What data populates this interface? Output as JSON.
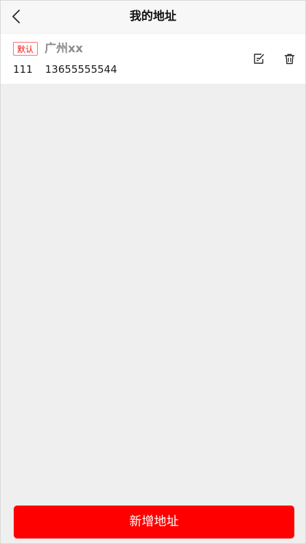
{
  "header": {
    "title": "我的地址",
    "back_icon": "chevron-left-icon"
  },
  "address_list": [
    {
      "badge": "默认",
      "address": "广州xx",
      "name": "111",
      "phone": "13655555544",
      "edit_icon": "edit-icon",
      "delete_icon": "trash-icon"
    }
  ],
  "footer": {
    "add_label": "新增地址"
  },
  "colors": {
    "accent": "#ff0000",
    "background": "#efefef",
    "header_bg": "#f7f7f7",
    "badge_red": "#f01010"
  }
}
